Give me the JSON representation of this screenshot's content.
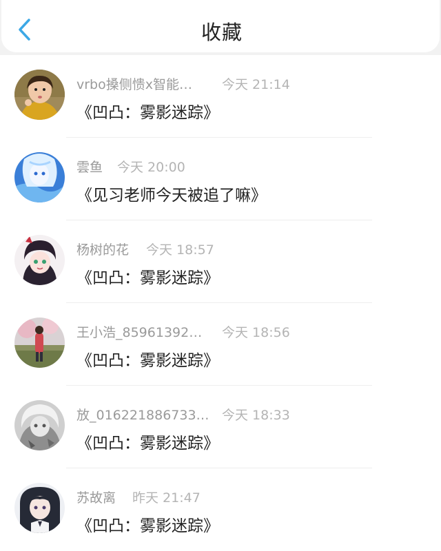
{
  "header": {
    "title": "收藏",
    "back_icon": "chevron-left-icon",
    "accent": "#3ca8e6"
  },
  "items": [
    {
      "name": "vrbo搡侧愦x智能…",
      "time": "今天  21:14",
      "message": "《凹凸：雾影迷踪》",
      "avatar": "child-photo"
    },
    {
      "name": "雲鱼",
      "time": "今天  20:00",
      "message": "《见习老师今天被追了嘛》",
      "avatar": "anime-blue"
    },
    {
      "name": "杨树的花",
      "time": "今天  18:57",
      "message": "《凹凸：雾影迷踪》",
      "avatar": "anime-dark-hair"
    },
    {
      "name": "王小浩_85961392…",
      "time": "今天  18:56",
      "message": "《凹凸：雾影迷踪》",
      "avatar": "garden-photo"
    },
    {
      "name": "放_016221886733…",
      "time": "今天  18:33",
      "message": "《凹凸：雾影迷踪》",
      "avatar": "anime-monochrome"
    },
    {
      "name": "苏故离",
      "time": "昨天  21:47",
      "message": "《凹凸：雾影迷踪》",
      "avatar": "anime-long-hair"
    }
  ]
}
